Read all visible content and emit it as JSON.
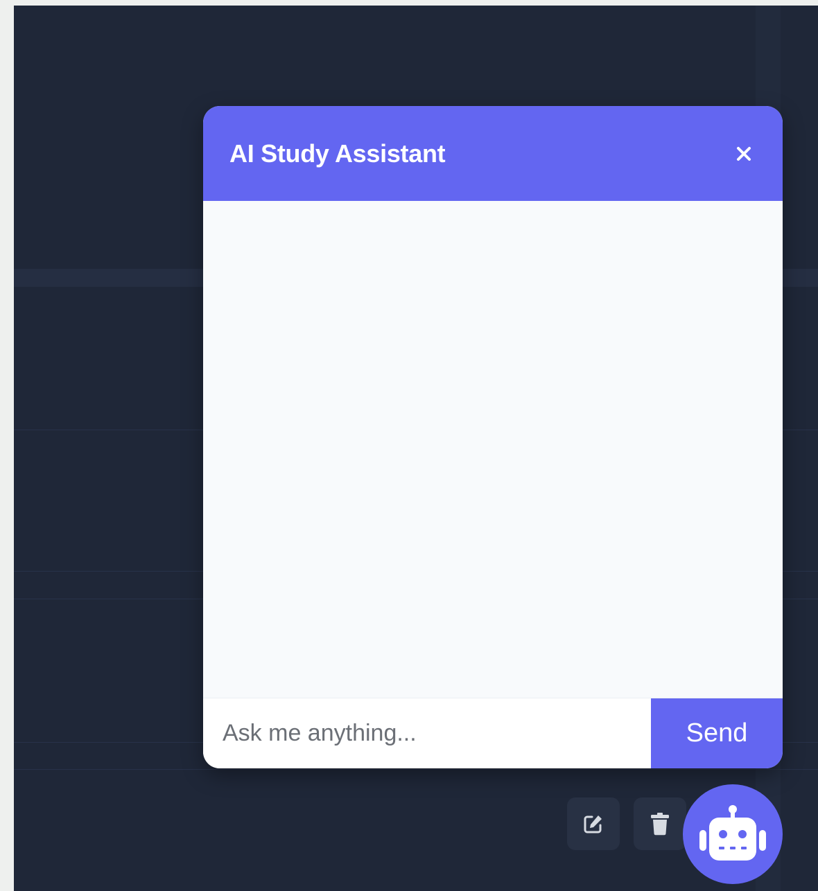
{
  "chat": {
    "title": "AI Study Assistant",
    "close_icon": "close-icon",
    "input_placeholder": "Ask me anything...",
    "input_value": "",
    "send_label": "Send"
  },
  "actions": {
    "edit_icon": "edit-icon",
    "delete_icon": "trash-icon"
  },
  "fab": {
    "icon": "robot-icon"
  },
  "colors": {
    "accent": "#6366f1",
    "background": "#1f2738",
    "panel": "#f8fafc",
    "action_button": "#283144"
  }
}
